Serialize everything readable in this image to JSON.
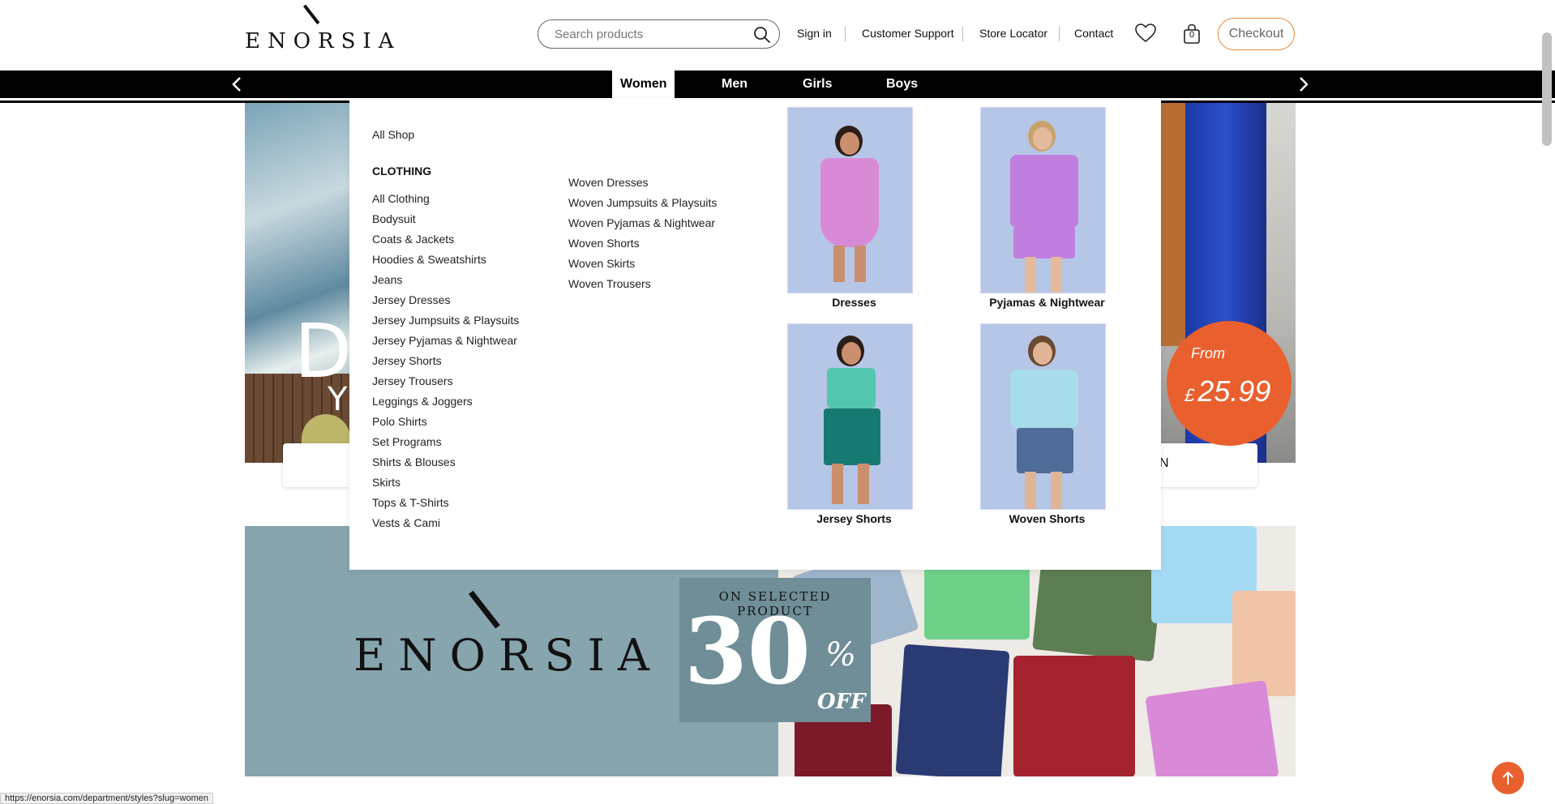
{
  "brand": {
    "name": "ENORSIA"
  },
  "search": {
    "placeholder": "Search products"
  },
  "topnav": {
    "sign_in": "Sign in",
    "customer_support": "Customer Support",
    "store_locator": "Store Locator",
    "contact": "Contact",
    "bag_count": "0",
    "checkout": "Checkout"
  },
  "categories": [
    "Women",
    "Men",
    "Girls",
    "Boys"
  ],
  "active_category": "Women",
  "hero": {
    "text_large": "DR",
    "text_small": "Y",
    "price_prefix": "From",
    "price_currency": "£",
    "price_value": "25.99",
    "card_text": "N"
  },
  "mega_menu": {
    "all_shop": "All Shop",
    "clothing_heading": "CLOTHING",
    "column1": [
      "All Clothing",
      "Bodysuit",
      "Coats & Jackets",
      "Hoodies & Sweatshirts",
      "Jeans",
      "Jersey Dresses",
      "Jersey Jumpsuits & Playsuits",
      "Jersey Pyjamas & Nightwear",
      "Jersey Shorts",
      "Jersey Trousers",
      "Leggings & Joggers",
      "Polo Shirts",
      "Set Programs",
      "Shirts & Blouses",
      "Skirts",
      "Tops & T-Shirts",
      "Vests & Cami"
    ],
    "column2": [
      "Woven Dresses",
      "Woven Jumpsuits & Playsuits",
      "Woven Pyjamas & Nightwear",
      "Woven Shorts",
      "Woven Skirts",
      "Woven Trousers"
    ],
    "featured": [
      {
        "label": "Dresses"
      },
      {
        "label": "Pyjamas & Nightwear"
      },
      {
        "label": "Jersey Shorts"
      },
      {
        "label": "Woven Shorts"
      }
    ]
  },
  "promo": {
    "badge_top": "ON SELECTED PRODUCT",
    "badge_number": "30",
    "badge_percent": "%",
    "badge_off": "OFF"
  },
  "status_bar": {
    "url": "https://enorsia.com/department/styles?slug=women"
  },
  "colors": {
    "accent": "#ea5f2e",
    "checkout_border": "#e8883b",
    "nav_bar": "#000000",
    "promo_left": "#87a5ae"
  }
}
